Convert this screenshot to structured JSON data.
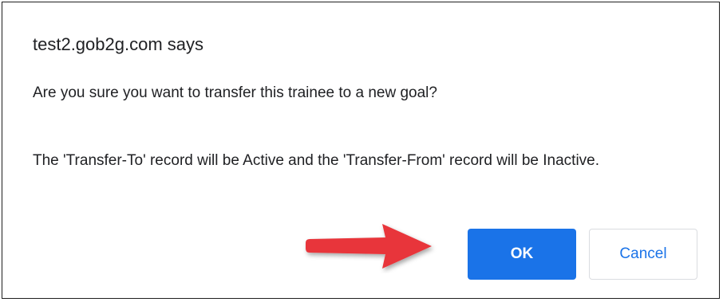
{
  "dialog": {
    "origin": "test2.gob2g.com says",
    "question": "Are you sure you want to transfer this trainee to a new goal?",
    "detail": "The 'Transfer-To' record will be Active and the 'Transfer-From' record will be Inactive.",
    "ok_label": "OK",
    "cancel_label": "Cancel"
  },
  "annotation": {
    "arrow_icon": "red-arrow-right-icon",
    "arrow_color": "#e8363a"
  },
  "colors": {
    "primary": "#1a73e8",
    "text": "#202124",
    "border": "#dadce0"
  }
}
